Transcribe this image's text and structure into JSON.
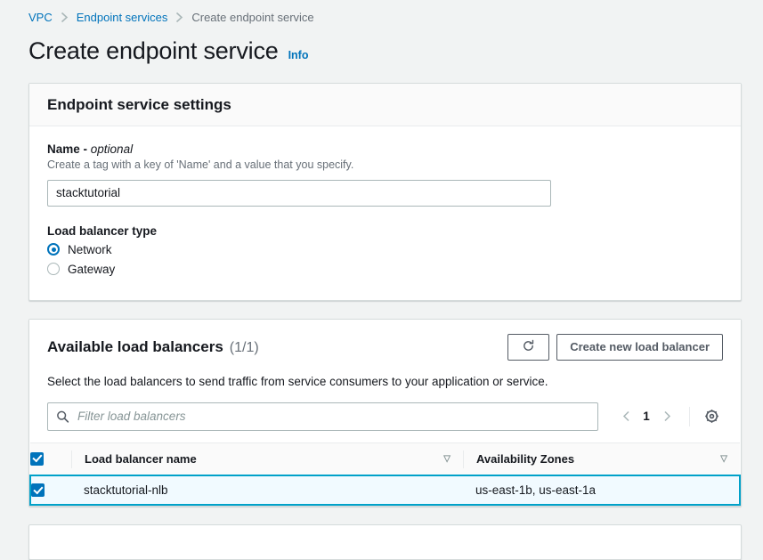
{
  "breadcrumb": {
    "items": [
      {
        "label": "VPC",
        "current": false
      },
      {
        "label": "Endpoint services",
        "current": false
      },
      {
        "label": "Create endpoint service",
        "current": true
      }
    ],
    "separator": "›"
  },
  "header": {
    "title": "Create endpoint service",
    "info_label": "Info"
  },
  "settings_panel": {
    "title": "Endpoint service settings",
    "name_field": {
      "label": "Name - ",
      "optional_text": "optional",
      "description": "Create a tag with a key of 'Name' and a value that you specify.",
      "value": "stacktutorial",
      "placeholder": ""
    },
    "load_balancer_type": {
      "label": "Load balancer type",
      "options": [
        {
          "label": "Network",
          "selected": true
        },
        {
          "label": "Gateway",
          "selected": false
        }
      ]
    }
  },
  "load_balancers_panel": {
    "title": "Available load balancers",
    "counter": "(1/1)",
    "refresh_icon": "refresh-icon",
    "create_button_label": "Create new load balancer",
    "description": "Select the load balancers to send traffic from service consumers to your application or service.",
    "search": {
      "placeholder": "Filter load balancers",
      "value": "",
      "icon": "search-icon"
    },
    "pagination": {
      "prev_icon": "chevron-left-icon",
      "page": "1",
      "next_icon": "chevron-right-icon"
    },
    "settings_icon": "gear-icon",
    "table": {
      "select_all_checked": true,
      "sort_icon": "▽",
      "columns": [
        {
          "label": "Load balancer name"
        },
        {
          "label": "Availability Zones"
        }
      ],
      "rows": [
        {
          "checked": true,
          "selected": true,
          "name": "stacktutorial-nlb",
          "availability_zones": "us-east-1b, us-east-1a"
        }
      ]
    }
  },
  "colors": {
    "link": "#0073bb",
    "page_bg": "#f1f3f3",
    "selected_row_bg": "#f1faff",
    "selected_row_border": "#00a1c9",
    "muted_text": "#687078"
  }
}
